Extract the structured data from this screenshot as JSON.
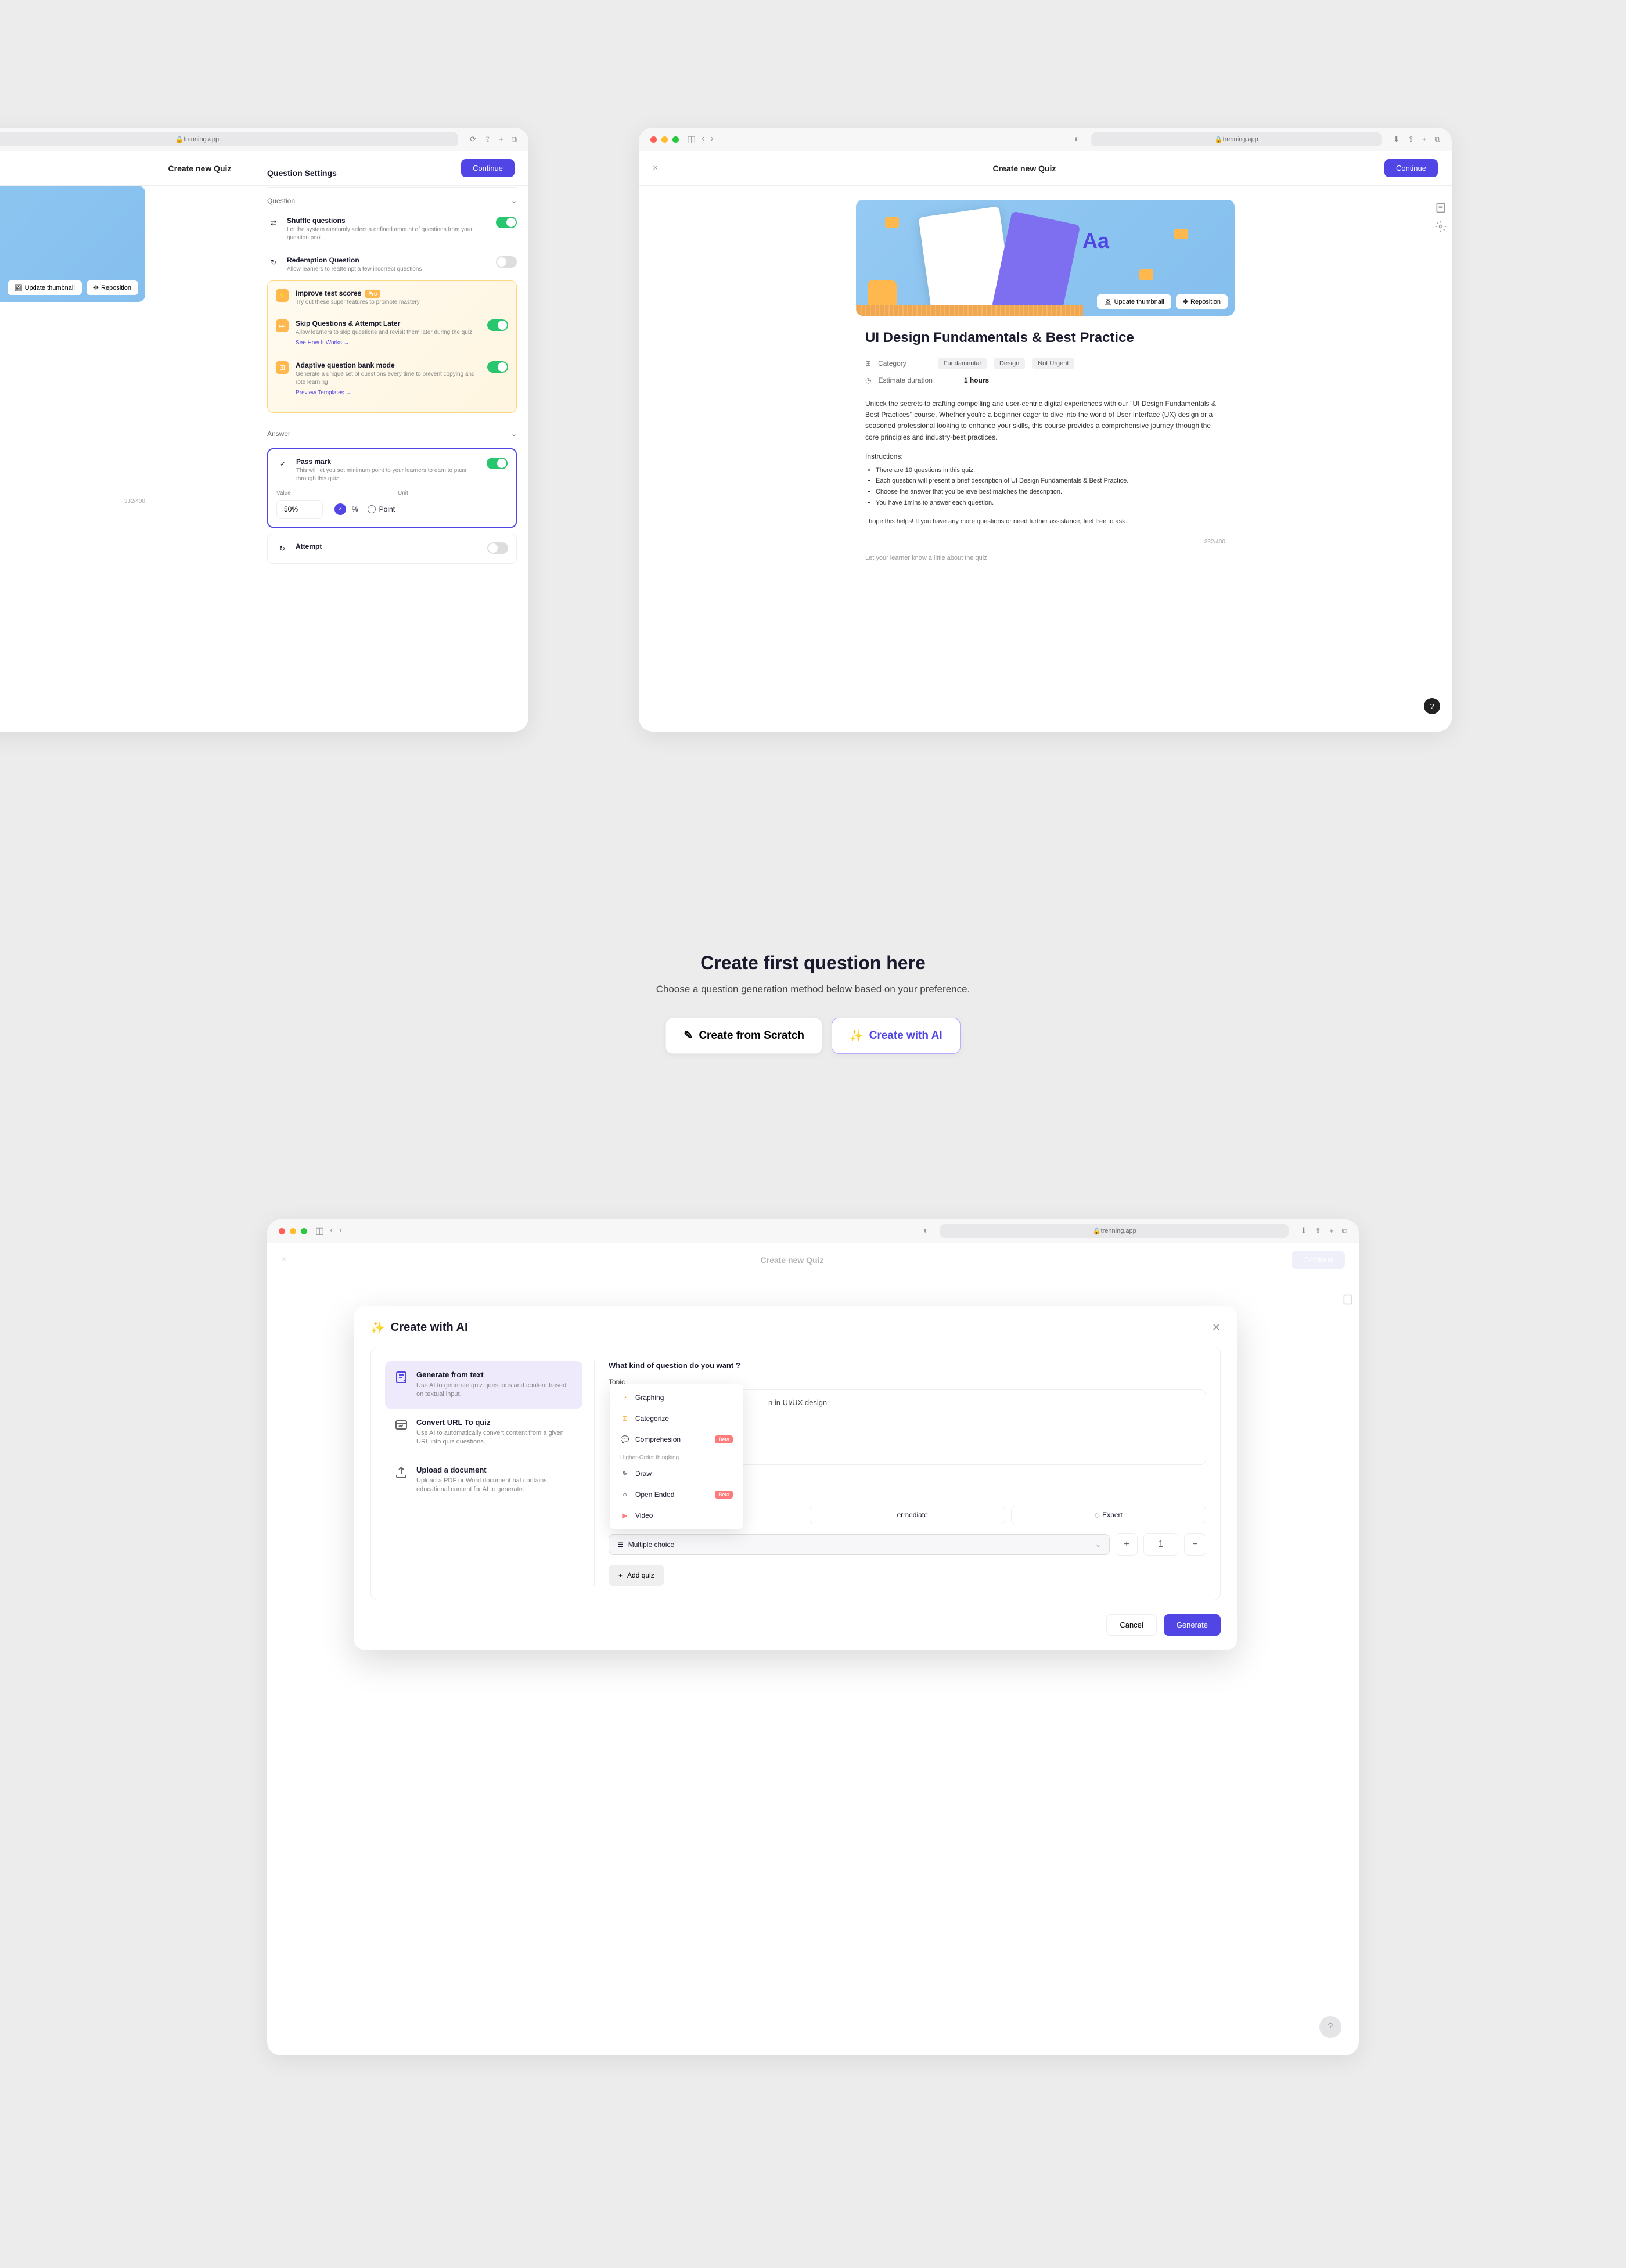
{
  "app_url": "trenning.app",
  "header": {
    "back_icon": "<",
    "close_icon": "×",
    "title": "Create new Quiz",
    "continue": "Continue"
  },
  "banner": {
    "text": "Aa",
    "update_thumb": "Update thumbnail",
    "reposition": "Reposition"
  },
  "quiz": {
    "title_full": "UI Design Fundamentals & Best Practice",
    "title_partial": "als & Best Practice",
    "category_label": "Category",
    "tags": [
      "Fundamental",
      "Design",
      "Not Urgent"
    ],
    "duration_label": "Estimate duration",
    "duration_value": "1 hours",
    "description": "Unlock the secrets to crafting compelling and user-centric digital experiences with our \"UI Design Fundamentals & Best Practices\" course. Whether you're a beginner eager to dive into the world of User Interface (UX) design or a seasoned professional looking to enhance your skills, this course provides a comprehensive journey through the core principles and industry-best practices.",
    "desc_partial": "centric digital experiences with our \"UI\nether you're a beginner eager to dive into\ned professional looking to enhance your\ny through the core principles and industry-",
    "instructions_label": "Instructions:",
    "bullets": [
      "There are 10 questions in this quiz.",
      "Each question will present a brief description of UI Design Fundamentals & Best Practice.",
      "Choose the answer that you believe best matches the description.",
      "You have 1mins to answer each question."
    ],
    "bullet_partial": "UI Design Fundamentals & Best Practice.\nes the description.",
    "closing": "I hope this helps! If you have any more questions or need further assistance, feel free to ask.",
    "closing_partial": "need further assistance, feel free to ask.",
    "char_count": "332/400",
    "placeholder": "Let your learner know a little about the quiz"
  },
  "settings": {
    "heading": "Question Settings",
    "section_question": "Question",
    "shuffle": {
      "title": "Shuffle questions",
      "sub": "Let the system randomly select a defined amount of questions from your question pool.",
      "on": true
    },
    "redemption": {
      "title": "Redemption Question",
      "sub": "Allow learners to reattempt a few incorrect questions",
      "on": false
    },
    "promo": {
      "title": "Improve test scores",
      "badge": "Pro",
      "sub": "Try out these super features to promote mastery"
    },
    "skip": {
      "title": "Skip Questions & Attempt Later",
      "sub": "Allow learners to skip questions and revisit them later during the quiz",
      "link": "See How It Works →",
      "on": true
    },
    "adaptive": {
      "title": "Adaptive question bank mode",
      "sub": "Generate a unique set of questions every time to prevent copying and rote learning",
      "link": "Preview Templates →",
      "on": true
    },
    "section_answer": "Answer",
    "passmark": {
      "title": "Pass mark",
      "sub": "This will let you set minimum point to your learners to earn to pass through this quiz",
      "on": true
    },
    "value_label": "Value",
    "value_val": "50%",
    "unit_label": "Unit",
    "unit_pct": "%",
    "unit_point": "Point",
    "attempt": {
      "title": "Attempt",
      "on": false
    }
  },
  "cta": {
    "title": "Create first question here",
    "sub": "Choose a question generation method below based on your preference.",
    "scratch": "Create from Scratch",
    "ai": "Create with AI"
  },
  "modal": {
    "title": "Create with AI",
    "methods": [
      {
        "title": "Generate from text",
        "sub": "Use AI to generate quiz questions and content based on textual input.",
        "active": true
      },
      {
        "title": "Convert URL To quiz",
        "sub": "Use AI to automatically convert content from a given URL into quiz questions."
      },
      {
        "title": "Upload a  document",
        "sub": "Upload a PDF or Word document hat contains educational content for AI to generate."
      }
    ],
    "form_heading": "What kind of question do you want ?",
    "topic_label": "Topic",
    "topic_partial": "n in UI/UX design",
    "dropdown": {
      "items": [
        {
          "label": "Graphing",
          "icon": "📈",
          "color": "#f5a623"
        },
        {
          "label": "Categorize",
          "icon": "⊞",
          "color": "#f5a623"
        },
        {
          "label": "Comprehesion",
          "icon": "💬",
          "color": "#f5a623",
          "beta": true
        }
      ],
      "group_label": "Higher-Order thingking",
      "items2": [
        {
          "label": "Draw",
          "icon": "✎"
        },
        {
          "label": "Open Ended",
          "icon": "○",
          "beta": true
        },
        {
          "label": "Video",
          "icon": "▶"
        }
      ]
    },
    "difficulty": [
      "ermediate",
      "Expert"
    ],
    "select_value": "Multiple choice",
    "counter": "1",
    "add_quiz": "Add quiz",
    "cancel": "Cancel",
    "generate": "Generate",
    "beta_label": "Beta"
  }
}
